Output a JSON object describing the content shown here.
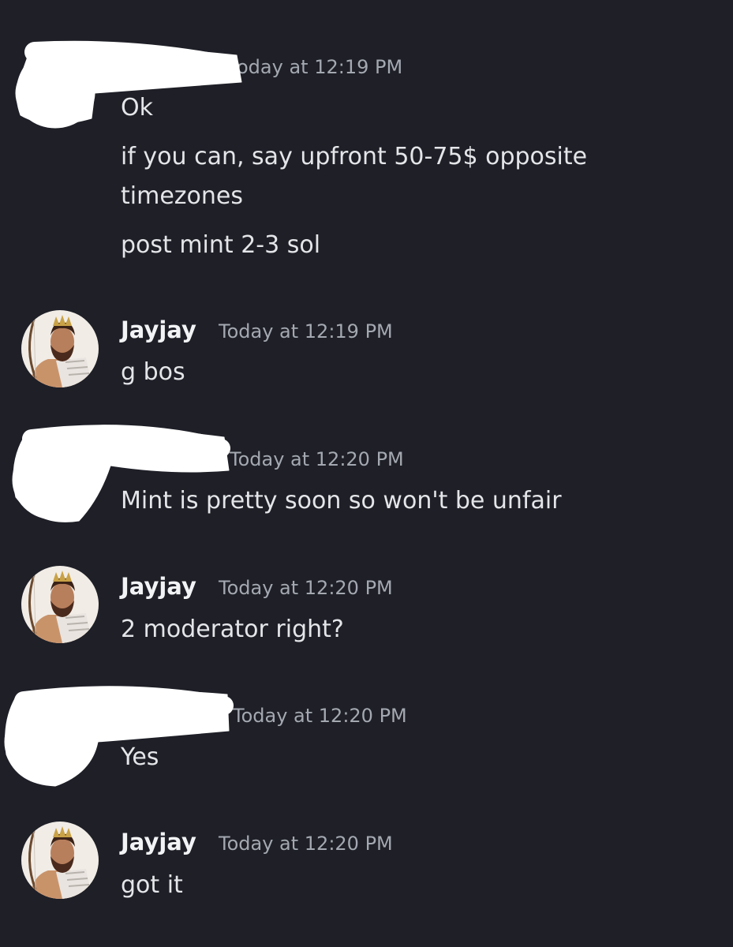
{
  "messages": [
    {
      "author": "",
      "author_redacted": true,
      "timestamp": "Today at 12:19 PM",
      "timestamp_partial": "oday at 12:19 PM",
      "lines": [
        "Ok",
        "if you can, say upfront 50-75$ opposite",
        "timezones",
        "post mint 2-3 sol"
      ]
    },
    {
      "author": "Jayjay",
      "timestamp": "Today at 12:19 PM",
      "lines": [
        "g bos"
      ]
    },
    {
      "author": "",
      "author_redacted": true,
      "timestamp": "Today at 12:20 PM",
      "lines": [
        "Mint is pretty soon so won't be unfair"
      ]
    },
    {
      "author": "Jayjay",
      "timestamp": "Today at 12:20 PM",
      "lines": [
        "2 moderator right?"
      ]
    },
    {
      "author": "",
      "author_redacted": true,
      "timestamp": "Today at 12:20 PM",
      "lines": [
        "Yes"
      ]
    },
    {
      "author": "Jayjay",
      "timestamp": "Today at 12:20 PM",
      "lines": [
        "got it"
      ]
    }
  ],
  "colors": {
    "background": "#1e1f27",
    "text": "#e3e5e8",
    "username": "#f2f3f5",
    "timestamp": "#a4a8b0",
    "redaction": "#ffffff"
  },
  "icons": {
    "avatar": "avatar-icon"
  }
}
